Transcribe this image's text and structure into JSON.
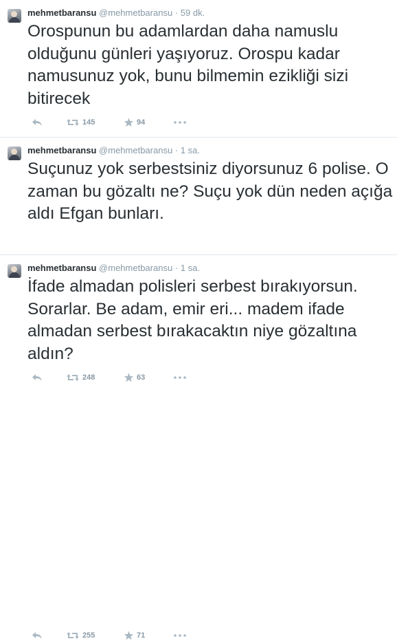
{
  "tweets": [
    {
      "fullname": "mehmetbaransu",
      "username": "@mehmetbaransu",
      "separator": "·",
      "time": "59 dk.",
      "text": "Orospunun bu adamlardan daha namuslu olduğunu günleri yaşıyoruz. Orospu kadar namusunuz yok, bunu bilmemin ezikliği sizi bitirecek",
      "retweets": "145",
      "favorites": "94"
    },
    {
      "fullname": "mehmetbaransu",
      "username": "@mehmetbaransu",
      "separator": "·",
      "time": "1 sa.",
      "text": "Suçunuz yok serbestsiniz diyorsunuz 6 polise. O zaman bu gözaltı ne? Suçu yok dün neden açığa aldı Efgan bunları.",
      "retweets": "248",
      "favorites": "63"
    },
    {
      "fullname": "mehmetbaransu",
      "username": "@mehmetbaransu",
      "separator": "·",
      "time": "1 sa.",
      "text": "İfade almadan polisleri serbest bırakıyorsun. Sorarlar. Be adam, emir eri... madem ifade almadan serbest bırakacaktın niye gözaltına aldın?",
      "retweets": "255",
      "favorites": "71"
    }
  ],
  "icons": {
    "reply": "reply-arrow",
    "retweet": "retweet-arrows",
    "favorite": "star",
    "more": "ellipsis"
  },
  "colors": {
    "text": "#292f33",
    "muted": "#8899a6",
    "icon": "#aab8c2",
    "divider": "#e1e8ed"
  }
}
